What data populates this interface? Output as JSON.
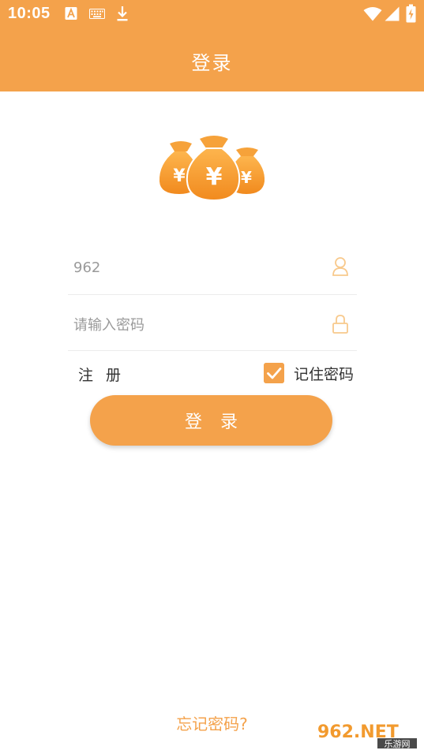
{
  "status_bar": {
    "time": "10:05",
    "icons": [
      "a-box-icon",
      "keyboard-icon",
      "download-icon",
      "wifi-icon",
      "signal-icon",
      "battery-icon"
    ]
  },
  "header": {
    "title": "登录"
  },
  "logo": {
    "icon": "money-bags-icon",
    "symbol": "¥"
  },
  "form": {
    "username_value": "962",
    "password_placeholder": "请输入密码",
    "register_label": "注 册",
    "remember_label": "记住密码",
    "remember_checked": true,
    "login_label": "登 录"
  },
  "forgot_label": "忘记密码?",
  "watermark": {
    "brand": "962.NET",
    "sub": "乐游网"
  },
  "colors": {
    "accent": "#F4A24B",
    "text": "#333333",
    "placeholder": "#9a9a9a",
    "divider": "#ececec"
  }
}
